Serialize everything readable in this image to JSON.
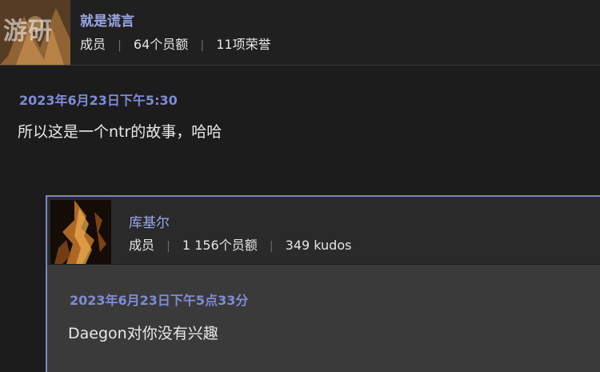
{
  "header": {
    "username": "就是谎言",
    "role": "成员",
    "credits": "64个员额",
    "honors": "11项荣誉",
    "watermark": "游研"
  },
  "post": {
    "date": "2023年6月23日下午5:30",
    "body": "所以这是一个ntr的故事，哈哈"
  },
  "quote": {
    "username": "库基尔",
    "role": "成员",
    "credits": "1 156个员额",
    "kudos": "349 kudos",
    "date": "2023年6月23日下午5点33分",
    "body": "Daegon对你没有兴趣"
  },
  "colors": {
    "accent": "#7e8cd6",
    "quote_border": "#7d85c4",
    "background": "#1c1c1c"
  }
}
